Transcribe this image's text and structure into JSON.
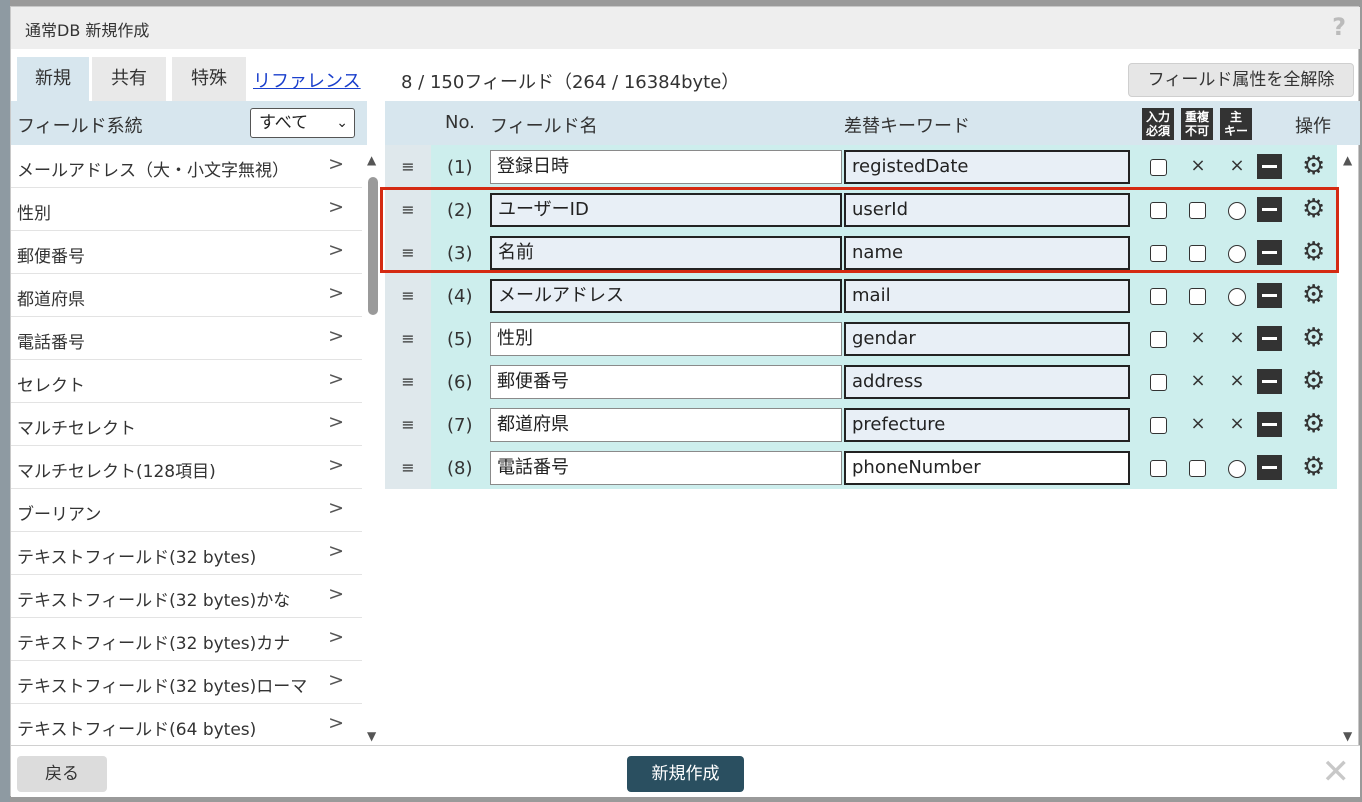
{
  "dialog": {
    "title": "通常DB 新規作成",
    "help_icon": "?",
    "close_icon": "✕"
  },
  "tabs": [
    {
      "label": "新規",
      "active": true
    },
    {
      "label": "共有",
      "active": false
    },
    {
      "label": "特殊",
      "active": false
    }
  ],
  "reference_link": "リファレンス",
  "field_count": "8 / 150フィールド（264 / 16384byte）",
  "clear_button": "フィールド属性を全解除",
  "left_panel": {
    "header": "フィールド系統",
    "filter_selected": "すべて",
    "items": [
      "メールアドレス（大・小文字無視）",
      "性別",
      "郵便番号",
      "都道府県",
      "電話番号",
      "セレクト",
      "マルチセレクト",
      "マルチセレクト(128項目)",
      "ブーリアン",
      "テキストフィールド(32 bytes)",
      "テキストフィールド(32 bytes)かな",
      "テキストフィールド(32 bytes)カナ",
      "テキストフィールド(32 bytes)ローマ",
      "テキストフィールド(64 bytes)"
    ],
    "arrow": ">"
  },
  "table": {
    "headers": {
      "no": "No.",
      "field_name": "フィールド名",
      "keyword": "差替キーワード",
      "required": "入力\n必須",
      "duplicate": "重複\n不可",
      "primary_key": "主\nキー",
      "ops": "操作"
    },
    "handle_icon": "≡",
    "gear_icon": "⚙",
    "rows": [
      {
        "no": "(1)",
        "name": "登録日時",
        "keyword": "registedDate",
        "dup": "×",
        "pk": "×"
      },
      {
        "no": "(2)",
        "name": "ユーザーID",
        "keyword": "userId",
        "dup": "checkbox",
        "pk": "○"
      },
      {
        "no": "(3)",
        "name": "名前",
        "keyword": "name",
        "dup": "checkbox",
        "pk": "○"
      },
      {
        "no": "(4)",
        "name": "メールアドレス",
        "keyword": "mail",
        "dup": "checkbox",
        "pk": "○"
      },
      {
        "no": "(5)",
        "name": "性別",
        "keyword": "gendar",
        "dup": "×",
        "pk": "×"
      },
      {
        "no": "(6)",
        "name": "郵便番号",
        "keyword": "address",
        "dup": "×",
        "pk": "×"
      },
      {
        "no": "(7)",
        "name": "都道府県",
        "keyword": "prefecture",
        "dup": "×",
        "pk": "×"
      },
      {
        "no": "(8)",
        "name": "電話番号",
        "keyword": "phoneNumber",
        "dup": "checkbox",
        "pk": "○"
      }
    ]
  },
  "footer": {
    "back": "戻る",
    "create": "新規作成"
  },
  "colors": {
    "header_bg": "#d7e6ee",
    "row_bg": "#cdeeed",
    "highlight": "#d42a12",
    "primary_button": "#2a4f60"
  }
}
